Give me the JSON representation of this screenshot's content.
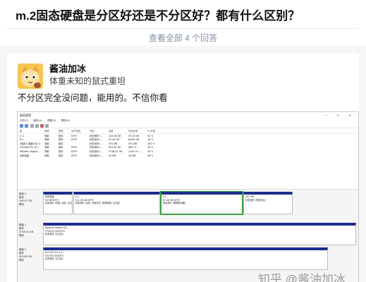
{
  "question": {
    "title": "m.2固态硬盘是分区好还是不分区好？都有什么区别？",
    "view_all": "查看全部 4 个回答"
  },
  "answer": {
    "author_name": "酱油加冰",
    "author_bio": "体重未知的鼠式重坦",
    "text": "不分区完全没问题，能用的。不信你看"
  },
  "screenshot": {
    "window_title": "磁盘管理",
    "window_controls": "— ☐ ✕",
    "menu": [
      "文件(F)",
      "操作(A)",
      "查看(V)",
      "帮助(H)"
    ],
    "table": {
      "columns": [
        "卷",
        "布局",
        "类型",
        "文件系统",
        "状态",
        "容量",
        "可用空间",
        "% 可用"
      ],
      "rows": [
        [
          "(C:)",
          "简单",
          "基本",
          "NTFS",
          "状态良好 (...",
          "110.36 GB",
          "59.28 GB",
          "54 %"
        ],
        [
          "(F:)",
          "简单",
          "基本",
          "NTFS",
          "状态良好 (...",
          "87.48 GB",
          "68.62 GB",
          "78 %"
        ],
        [
          "(磁盘 0 磁盘分区 4)",
          "简单",
          "基本",
          "",
          "状态良好 (...",
          "591 MB",
          "591 MB",
          "100 %"
        ],
        [
          "HV2000 Pro (G:)",
          "简单",
          "基本",
          "NTFS",
          "状态良好 (...",
          "953.85 GB",
          "469.77 ...",
          "49 %"
        ],
        [
          "Western Digital ...",
          "简单",
          "基本",
          "NTFS",
          "状态良好 (...",
          "3726.01 GB",
          "1104.19 ...",
          "30 %"
        ],
        [
          "系统保留",
          "简单",
          "基本",
          "NTFS",
          "状态良好 (...",
          "50 MB",
          "18 MB",
          "36 %"
        ]
      ]
    },
    "disks": [
      {
        "label": [
          "磁盘 0",
          "基本",
          "198.47 GB",
          "联机"
        ],
        "partitions": [
          {
            "lines": [
              "系统保留",
              "50 MB NTFS",
              "状态良好 (系统, 活动, 主分区)"
            ],
            "width_pct": 12,
            "selected": false
          },
          {
            "lines": [
              "(C:)",
              "110.36 GB NTFS",
              "状态良好 (启动, 页面文件, 故障转储, 主分区)"
            ],
            "width_pct": 35,
            "selected": false
          },
          {
            "lines": [
              "(F:)",
              "87.48 GB NTFS",
              "状态良好 (逻辑驱动器)"
            ],
            "width_pct": 33,
            "selected": true
          },
          {
            "lines": [
              "",
              "591 MB",
              "状态良好 (恢复分区)"
            ],
            "width_pct": 20,
            "selected": false
          }
        ]
      },
      {
        "label": [
          "磁盘 1",
          "基本",
          "3726.01 GB",
          "联机"
        ],
        "partitions": [
          {
            "lines": [
              "Western Digital (D:)",
              "3726.01 GB NTFS",
              "状态良好 (主分区)"
            ],
            "width_pct": 100,
            "selected": false
          }
        ]
      },
      {
        "label": [
          "磁盘 2",
          "基本",
          "953.85 GB",
          "联机"
        ],
        "partitions": [
          {
            "lines": [
              "HV2000 Pro (G:)",
              "953.85 GB NTFS",
              "状态良好 (主分区)"
            ],
            "width_pct": 100,
            "selected": false
          }
        ]
      }
    ]
  },
  "watermark": "知乎 @酱油加冰",
  "colors": {
    "partition_header": "#1b2e8c",
    "selected_outline": "#3aa040",
    "muted_text": "#8590a6"
  }
}
